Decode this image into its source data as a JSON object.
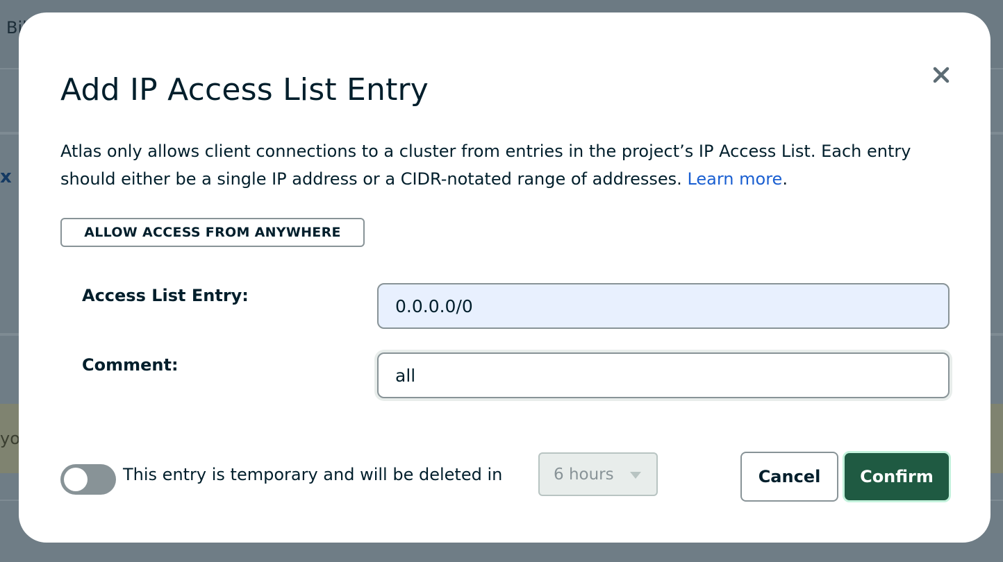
{
  "background": {
    "fragment_top": "Bil",
    "fragment_mid": "x",
    "fragment_bottom": "you"
  },
  "modal": {
    "title": "Add IP Access List Entry",
    "close_icon": "close-icon",
    "description": "Atlas only allows client connections to a cluster from entries in the project’s IP Access List. Each entry should either be a single IP address or a CIDR-notated range of addresses. ",
    "learn_more": "Learn more",
    "description_end": ".",
    "allow_anywhere_label": "ALLOW ACCESS FROM ANYWHERE",
    "access_list_entry": {
      "label": "Access List Entry:",
      "value": "0.0.0.0/0"
    },
    "comment": {
      "label": "Comment:",
      "value": "all"
    },
    "temporary": {
      "enabled": false,
      "text": "This entry is temporary and will be deleted in",
      "duration": "6 hours"
    },
    "cancel_label": "Cancel",
    "confirm_label": "Confirm"
  },
  "colors": {
    "accent_green": "#1f5a42",
    "link_blue": "#1a5fd1",
    "text_dark": "#001e2b"
  }
}
